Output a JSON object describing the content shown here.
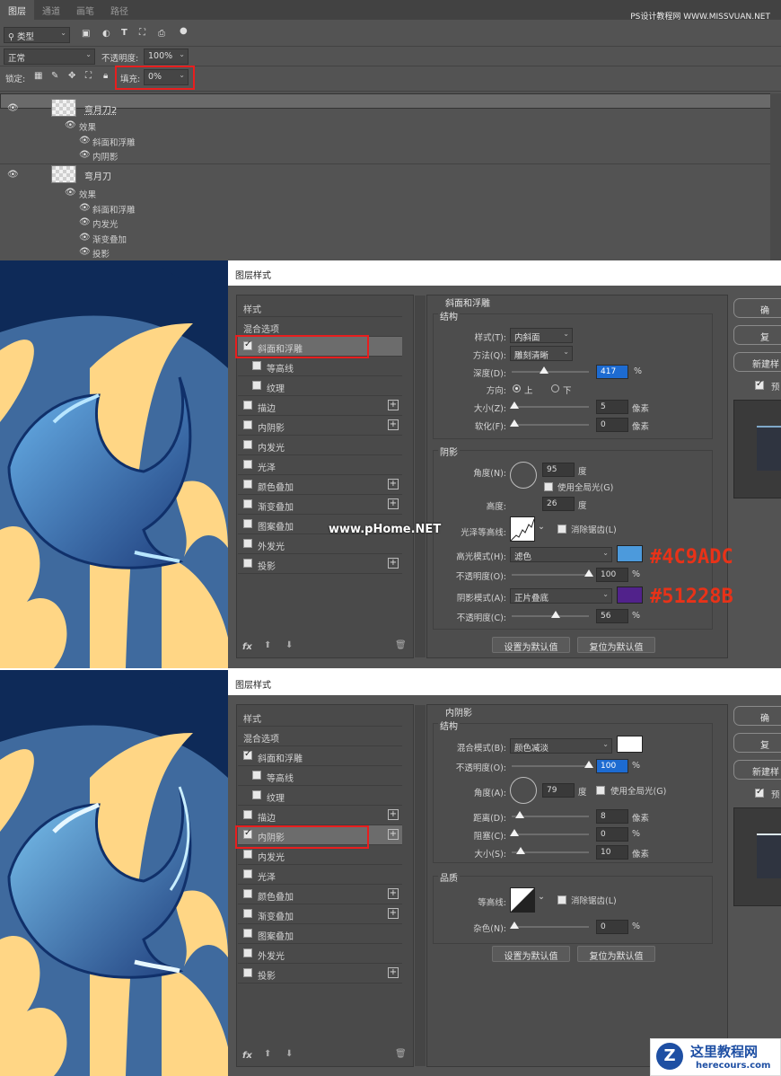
{
  "site_watermark": "PS设计教程网 WWW.MISSVUAN.NET",
  "layers_panel": {
    "tabs": [
      "图层",
      "通道",
      "画笔",
      "路径"
    ],
    "filter_kind": "类型",
    "blend_mode": "正常",
    "opacity_label": "不透明度:",
    "opacity_value": "100%",
    "lock_label": "锁定:",
    "fill_label": "填充:",
    "fill_value": "0%",
    "layers": [
      {
        "name": "弯月刀2",
        "effects_label": "效果",
        "effects": [
          "斜面和浮雕",
          "内阴影"
        ]
      },
      {
        "name": "弯月刀",
        "effects_label": "效果",
        "effects": [
          "斜面和浮雕",
          "内发光",
          "渐变叠加",
          "投影"
        ]
      }
    ]
  },
  "dialog_title": "图层样式",
  "style_list": {
    "header": "样式",
    "items": [
      "混合选项",
      "斜面和浮雕",
      "等高线",
      "纹理",
      "描边",
      "内阴影",
      "内发光",
      "光泽",
      "颜色叠加",
      "渐变叠加",
      "图案叠加",
      "外发光",
      "投影"
    ],
    "fx_label": "fx"
  },
  "dialog1": {
    "section_title": "斜面和浮雕",
    "structure_label": "结构",
    "style_label": "样式(T):",
    "style_value": "内斜面",
    "technique_label": "方法(Q):",
    "technique_value": "雕刻清晰",
    "depth_label": "深度(D):",
    "depth_value": "417",
    "depth_unit": "%",
    "direction_label": "方向:",
    "dir_up": "上",
    "dir_down": "下",
    "size_label": "大小(Z):",
    "size_value": "5",
    "size_unit": "像素",
    "soften_label": "软化(F):",
    "soften_value": "0",
    "soften_unit": "像素",
    "shading_label": "阴影",
    "angle_label": "角度(N):",
    "angle_value": "95",
    "angle_unit": "度",
    "global_light": "使用全局光(G)",
    "altitude_label": "高度:",
    "altitude_value": "26",
    "altitude_unit": "度",
    "gloss_label": "光泽等高线:",
    "antialias": "消除锯齿(L)",
    "highlight_label": "高光模式(H):",
    "highlight_value": "滤色",
    "highlight_color": "#4C9ADC",
    "highlight_note": "#4C9ADC",
    "hl_opacity_label": "不透明度(O):",
    "hl_opacity_value": "100",
    "hl_opacity_unit": "%",
    "shadow_label": "阴影模式(A):",
    "shadow_value": "正片叠底",
    "shadow_color": "#51228B",
    "shadow_note": "#51228B",
    "sh_opacity_label": "不透明度(C):",
    "sh_opacity_value": "56",
    "sh_opacity_unit": "%",
    "btn_default": "设置为默认值",
    "btn_reset": "复位为默认值",
    "right_buttons": [
      "确",
      "复",
      "新建样"
    ],
    "preview_label": "预",
    "center_watermark": "www.pHome.NET"
  },
  "dialog2": {
    "section_title": "内阴影",
    "structure_label": "结构",
    "blend_label": "混合模式(B):",
    "blend_value": "颜色减淡",
    "opacity_label": "不透明度(O):",
    "opacity_value": "100",
    "opacity_unit": "%",
    "angle_label": "角度(A):",
    "angle_value": "79",
    "angle_unit": "度",
    "global_light": "使用全局光(G)",
    "distance_label": "距离(D):",
    "distance_value": "8",
    "distance_unit": "像素",
    "choke_label": "阻塞(C):",
    "choke_value": "0",
    "choke_unit": "%",
    "size_label": "大小(S):",
    "size_value": "10",
    "size_unit": "像素",
    "quality_label": "品质",
    "contour_label": "等高线:",
    "antialias": "消除锯齿(L)",
    "noise_label": "杂色(N):",
    "noise_value": "0",
    "noise_unit": "%",
    "btn_default": "设置为默认值",
    "btn_reset": "复位为默认值",
    "right_buttons": [
      "确",
      "复",
      "新建样"
    ],
    "preview_label": "预"
  },
  "footer_logo": {
    "title": "这里教程网",
    "url": "herecours.com"
  }
}
